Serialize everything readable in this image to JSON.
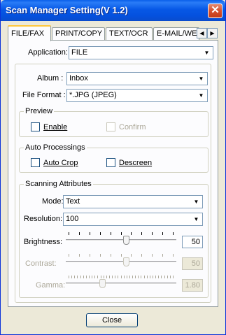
{
  "window": {
    "title": "Scan Manager Setting(V 1.2)"
  },
  "tabs": [
    "FILE/FAX",
    "PRINT/COPY",
    "TEXT/OCR",
    "E-MAIL/WE"
  ],
  "application": {
    "label": "Application:",
    "value": "FILE"
  },
  "album": {
    "label": "Album :",
    "value": "Inbox"
  },
  "file_format": {
    "label": "File Format :",
    "value": "*.JPG (JPEG)"
  },
  "preview": {
    "title": "Preview",
    "enable_label": "Enable",
    "confirm_label": "Confirm"
  },
  "auto": {
    "title": "Auto Processings",
    "auto_crop_label": "Auto Crop",
    "descreen_label": "Descreen"
  },
  "scanning": {
    "title": "Scanning Attributes",
    "mode_label": "Mode:",
    "mode_value": "Text",
    "resolution_label": "Resolution:",
    "resolution_value": "100",
    "brightness_label": "Brightness:",
    "brightness_value": "50",
    "contrast_label": "Contrast:",
    "contrast_value": "50",
    "gamma_label": "Gamma:",
    "gamma_value": "1.80"
  },
  "close_label": "Close"
}
